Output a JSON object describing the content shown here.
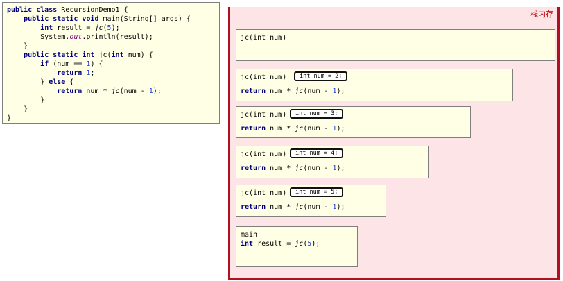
{
  "code_lines": [
    [
      [
        "kw",
        "public class "
      ],
      [
        "",
        "RecursionDemo1 {"
      ]
    ],
    [
      [
        "",
        "    "
      ],
      [
        "kw",
        "public static void "
      ],
      [
        "",
        "main(String[] args) {"
      ]
    ],
    [
      [
        "",
        "        "
      ],
      [
        "kw",
        "int "
      ],
      [
        "",
        "result = "
      ],
      [
        "it",
        "jc"
      ],
      [
        "",
        "("
      ],
      [
        "num",
        "5"
      ],
      [
        "",
        ");"
      ]
    ],
    [
      [
        "",
        "        System."
      ],
      [
        "st",
        "out"
      ],
      [
        "",
        ".println(result);"
      ]
    ],
    [
      [
        "",
        "    }"
      ]
    ],
    [
      [
        "",
        "    "
      ],
      [
        "kw",
        "public static int "
      ],
      [
        "",
        "jc("
      ],
      [
        "kw",
        "int "
      ],
      [
        "",
        "num) {"
      ]
    ],
    [
      [
        "",
        "        "
      ],
      [
        "kw",
        "if "
      ],
      [
        "",
        "(num == "
      ],
      [
        "num",
        "1"
      ],
      [
        "",
        ") {"
      ]
    ],
    [
      [
        "",
        "            "
      ],
      [
        "kw",
        "return "
      ],
      [
        "num",
        "1"
      ],
      [
        "",
        ";"
      ]
    ],
    [
      [
        "",
        "        } "
      ],
      [
        "kw",
        "else "
      ],
      [
        "",
        "{"
      ]
    ],
    [
      [
        "",
        "            "
      ],
      [
        "kw",
        "return "
      ],
      [
        "",
        "num * "
      ],
      [
        "it",
        "jc"
      ],
      [
        "",
        "(num - "
      ],
      [
        "num",
        "1"
      ],
      [
        "",
        ");"
      ]
    ],
    [
      [
        "",
        "        }"
      ]
    ],
    [
      [
        "",
        "    }"
      ]
    ],
    [
      [
        "",
        "}"
      ]
    ]
  ],
  "stack_label": "栈内存",
  "frames": {
    "f1": {
      "header": "jc(int num)"
    },
    "f2": {
      "header": "jc(int num)",
      "var": "int num = 2;",
      "ret_kw": "return",
      "ret_pre": " num * ",
      "ret_call": "jc",
      "ret_mid": "(num - ",
      "ret_num": "1",
      "ret_end": ");"
    },
    "f3": {
      "header": "jc(int num)",
      "var": "int num = 3;",
      "ret_kw": "return",
      "ret_pre": " num * ",
      "ret_call": "jc",
      "ret_mid": "(num - ",
      "ret_num": "1",
      "ret_end": ");"
    },
    "f4": {
      "header": "jc(int num)",
      "var": "int num = 4;",
      "ret_kw": "return",
      "ret_pre": " num * ",
      "ret_call": "jc",
      "ret_mid": "(num - ",
      "ret_num": "1",
      "ret_end": ");"
    },
    "f5": {
      "header": "jc(int num)",
      "var": "int num = 5;",
      "ret_kw": "return",
      "ret_pre": " num * ",
      "ret_call": "jc",
      "ret_mid": "(num - ",
      "ret_num": "1",
      "ret_end": ");"
    },
    "main": {
      "header": "main",
      "kw": "int",
      "pre": " result = ",
      "call": "jc",
      "open": "(",
      "num": "5",
      "end": ");"
    }
  }
}
